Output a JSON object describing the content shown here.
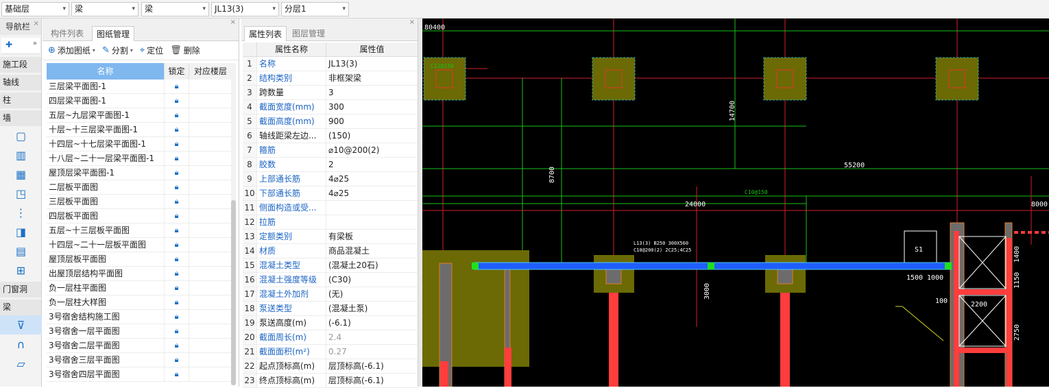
{
  "top_dropdowns": [
    {
      "value": "基础层"
    },
    {
      "value": "梁"
    },
    {
      "value": "梁"
    },
    {
      "value": "JL13(3)"
    },
    {
      "value": "分层1"
    }
  ],
  "nav": {
    "title": "导航栏",
    "categories": [
      "施工段",
      "轴线",
      "柱",
      "墙",
      "门窗洞",
      "梁"
    ]
  },
  "drawings_panel": {
    "tabs": [
      "构件列表",
      "图纸管理"
    ],
    "active_tab": "图纸管理",
    "toolbar": {
      "add": "添加图纸",
      "split": "分割",
      "locate": "定位",
      "delete": "删除"
    },
    "columns": [
      "名称",
      "锁定",
      "对应楼层"
    ],
    "rows": [
      "三层梁平面图-1",
      "四层梁平面图-1",
      "五层~九层梁平面图-1",
      "十层~十三层梁平面图-1",
      "十四层~十七层梁平面图-1",
      "十八层~二十一层梁平面图-1",
      "屋顶层梁平面图-1",
      "二层板平面图",
      "三层板平面图",
      "四层板平面图",
      "五层~十三层板平面图",
      "十四层~二十一层板平面图",
      "屋顶层板平面图",
      "出屋顶层结构平面图",
      "负一层柱平面图",
      "负一层柱大样图",
      "3号宿舍结构施工图",
      "3号宿舍一层平面图",
      "3号宿舍二层平面图",
      "3号宿舍三层平面图",
      "3号宿舍四层平面图"
    ]
  },
  "props_panel": {
    "tabs": [
      "属性列表",
      "图层管理"
    ],
    "active_tab": "属性列表",
    "columns": [
      "属性名称",
      "属性值"
    ],
    "rows": [
      {
        "n": "1",
        "k": "名称",
        "v": "JL13(3)",
        "blue": true
      },
      {
        "n": "2",
        "k": "结构类别",
        "v": "非框架梁",
        "blue": true
      },
      {
        "n": "3",
        "k": "跨数量",
        "v": "3",
        "blue": false
      },
      {
        "n": "4",
        "k": "截面宽度(mm)",
        "v": "300",
        "blue": true
      },
      {
        "n": "5",
        "k": "截面高度(mm)",
        "v": "900",
        "blue": true
      },
      {
        "n": "6",
        "k": "轴线距梁左边...",
        "v": "(150)",
        "blue": false
      },
      {
        "n": "7",
        "k": "箍筋",
        "v": "⌀10@200(2)",
        "blue": true
      },
      {
        "n": "8",
        "k": "胶数",
        "v": "2",
        "blue": true
      },
      {
        "n": "9",
        "k": "上部通长筋",
        "v": "4⌀25",
        "blue": true
      },
      {
        "n": "10",
        "k": "下部通长筋",
        "v": "4⌀25",
        "blue": true
      },
      {
        "n": "11",
        "k": "侧面构造或受...",
        "v": "",
        "blue": true
      },
      {
        "n": "12",
        "k": "拉筋",
        "v": "",
        "blue": true
      },
      {
        "n": "13",
        "k": "定额类别",
        "v": "有梁板",
        "blue": true
      },
      {
        "n": "14",
        "k": "材质",
        "v": "商品混凝土",
        "blue": true
      },
      {
        "n": "15",
        "k": "混凝土类型",
        "v": "(混凝土20石)",
        "blue": true
      },
      {
        "n": "16",
        "k": "混凝土强度等级",
        "v": "(C30)",
        "blue": true
      },
      {
        "n": "17",
        "k": "混凝土外加剂",
        "v": "(无)",
        "blue": true
      },
      {
        "n": "18",
        "k": "泵送类型",
        "v": "(混凝土泵)",
        "blue": true
      },
      {
        "n": "19",
        "k": "泵送高度(m)",
        "v": "(-6.1)",
        "blue": false
      },
      {
        "n": "20",
        "k": "截面周长(m)",
        "v": "2.4",
        "blue": true,
        "gray": true
      },
      {
        "n": "21",
        "k": "截面面积(m²)",
        "v": "0.27",
        "blue": true,
        "gray": true
      },
      {
        "n": "22",
        "k": "起点顶标高(m)",
        "v": "层顶标高(-6.1)",
        "blue": false
      },
      {
        "n": "23",
        "k": "终点顶标高(m)",
        "v": "层顶标高(-6.1)",
        "blue": false
      }
    ]
  },
  "cad": {
    "labels": {
      "top_left": "80400",
      "dim_55200": "55200",
      "dim_24000": "24000",
      "dim_8000": "8000",
      "dim_8700": "8700",
      "dim_14700": "14700",
      "dim_1500": "1500",
      "dim_1000": "1000",
      "dim_2200": "2200",
      "dim_1400": "1400",
      "dim_1150": "1150",
      "dim_2750": "2750",
      "dim_100": "100",
      "dim_3000": "3000",
      "dim_1000b": "1000",
      "s1": "S1",
      "c12": "C12@150",
      "c10": "C10@150",
      "beam_note1": "L13(3) B250 300X560",
      "beam_note2": "C10@200(2) 2C25;4C25"
    }
  }
}
